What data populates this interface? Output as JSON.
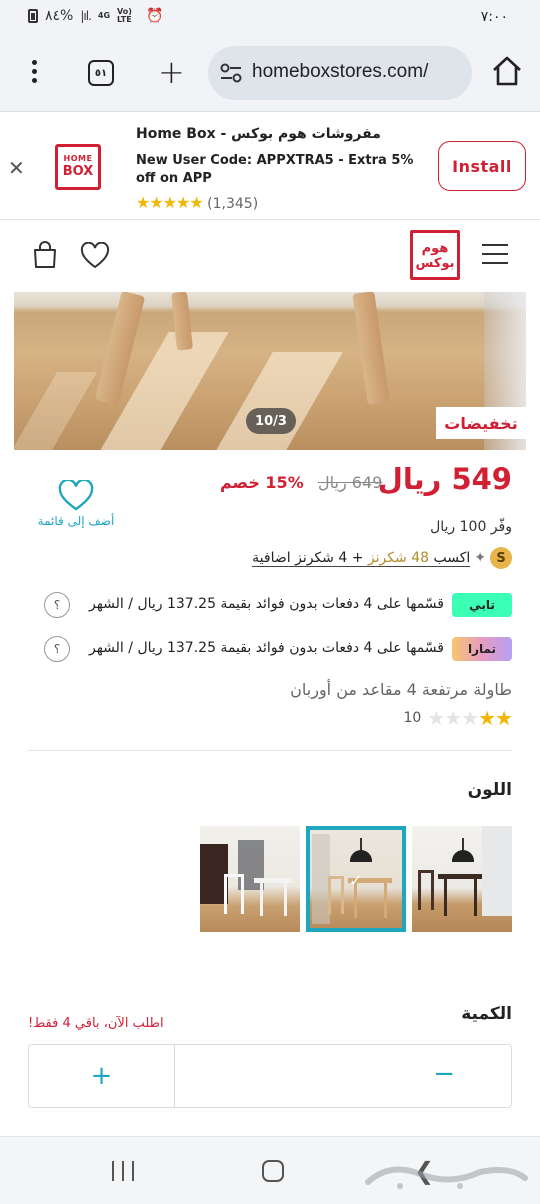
{
  "status_bar": {
    "time": "٧:٠٠",
    "battery": "٨٤%",
    "signal": "Vo) LTE",
    "network": "4G"
  },
  "browser": {
    "tabs_count": "٥١",
    "url": "homeboxstores.com/"
  },
  "app_banner": {
    "title": "Home Box - مفروشات هوم بوكس",
    "description": "New User Code: APPXTRA5 - Extra 5% off on APP",
    "stars": "★★★★★",
    "rating_count": "(1,345)",
    "install_label": "Install",
    "logo_line1": "HOME",
    "logo_line2": "BOX"
  },
  "header": {
    "logo_line1": "هوم",
    "logo_line2": "بوكس"
  },
  "gallery": {
    "pager": "10/3",
    "sale_tag": "تخفيضات"
  },
  "product": {
    "price_now": "549 ريال",
    "price_old": "649 ريال",
    "discount": "15% خصم",
    "wishlist_label": "أضف إلى قائمة",
    "save_text": "وفّر 100 ريال",
    "shukrans_prefix": "اكسب ",
    "shukrans_gold": "48 شكرنز",
    "shukrans_suffix": " + 4 شكرنز اضافية",
    "shukrans_coin": "S",
    "title": "طاولة مرتفعة 4 مقاعد من أوربان",
    "stars_on": "★★",
    "stars_off": "★★★",
    "review_count": "10"
  },
  "payments": [
    {
      "brand": "تابي",
      "text": "قسّمها على 4 دفعات بدون فوائد بقيمة 137.25 ريال / الشهر",
      "help": "؟"
    },
    {
      "brand": "تمارا",
      "text": "قسّمها على 4 دفعات بدون فوائد بقيمة 137.25 ريال / الشهر",
      "help": "؟"
    }
  ],
  "color_section": {
    "label": "اللون",
    "selected_index": 1
  },
  "quantity_section": {
    "label": "الكمية",
    "stock_note": "اطلب الآن، باقي 4 فقط!",
    "plus": "+",
    "minus": "−"
  },
  "colors": {
    "brand_red": "#d11f34",
    "accent_teal": "#1fa7c0",
    "star_gold": "#f2b705"
  }
}
